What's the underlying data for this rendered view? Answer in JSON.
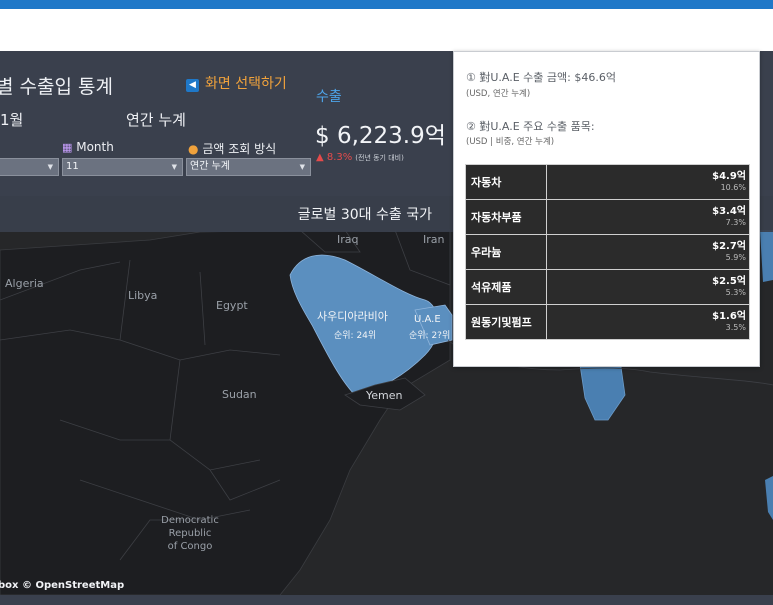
{
  "header": {
    "title": "별 수출입 통계",
    "screen_select": "화면 선택하기",
    "month_value": "1월",
    "cumulative_label": "연간 누계",
    "export_label": "수출",
    "export_amount": "$ 6,223.9억",
    "export_change": "▲ 8.3%",
    "export_change_note": "(전년 동기 대비)"
  },
  "filters": {
    "month_label": "Month",
    "month_value": "11",
    "amount_mode_label": "금액 조회 방식",
    "amount_mode_value": "연간 누계"
  },
  "map": {
    "title": "글로벌 30대 수출 국가",
    "attribution": "box © OpenStreetMap",
    "labels": {
      "algeria": "Algeria",
      "libya": "Libya",
      "egypt": "Egypt",
      "sudan": "Sudan",
      "yemen": "Yemen",
      "iraq": "Iraq",
      "iran": "Iran",
      "drc1": "Democratic",
      "drc2": "Republic",
      "drc3": "of Congo",
      "saudi": "사우디아라비아",
      "saudi_rank": "순위: 24위",
      "uae": "U.A.E",
      "uae_rank": "순위: 2?위"
    },
    "colors": {
      "highlight": "#5b8fbf",
      "land": "#1e1f22",
      "sea": "#2a2b2e"
    }
  },
  "tooltip": {
    "line1": "① 對U.A.E 수출 금액: $46.6억",
    "line2": "(USD, 연간 누계)",
    "line3": "② 對U.A.E 주요 수출 품목:",
    "line4": "(USD | 비중, 연간 누계)",
    "rows": [
      {
        "name": "자동차",
        "value": "$4.9억",
        "pct": "10.6%"
      },
      {
        "name": "자동차부품",
        "value": "$3.4억",
        "pct": "7.3%"
      },
      {
        "name": "우라늄",
        "value": "$2.7억",
        "pct": "5.9%"
      },
      {
        "name": "석유제품",
        "value": "$2.5억",
        "pct": "5.3%"
      },
      {
        "name": "원동기및펌프",
        "value": "$1.6억",
        "pct": "3.5%"
      }
    ]
  }
}
